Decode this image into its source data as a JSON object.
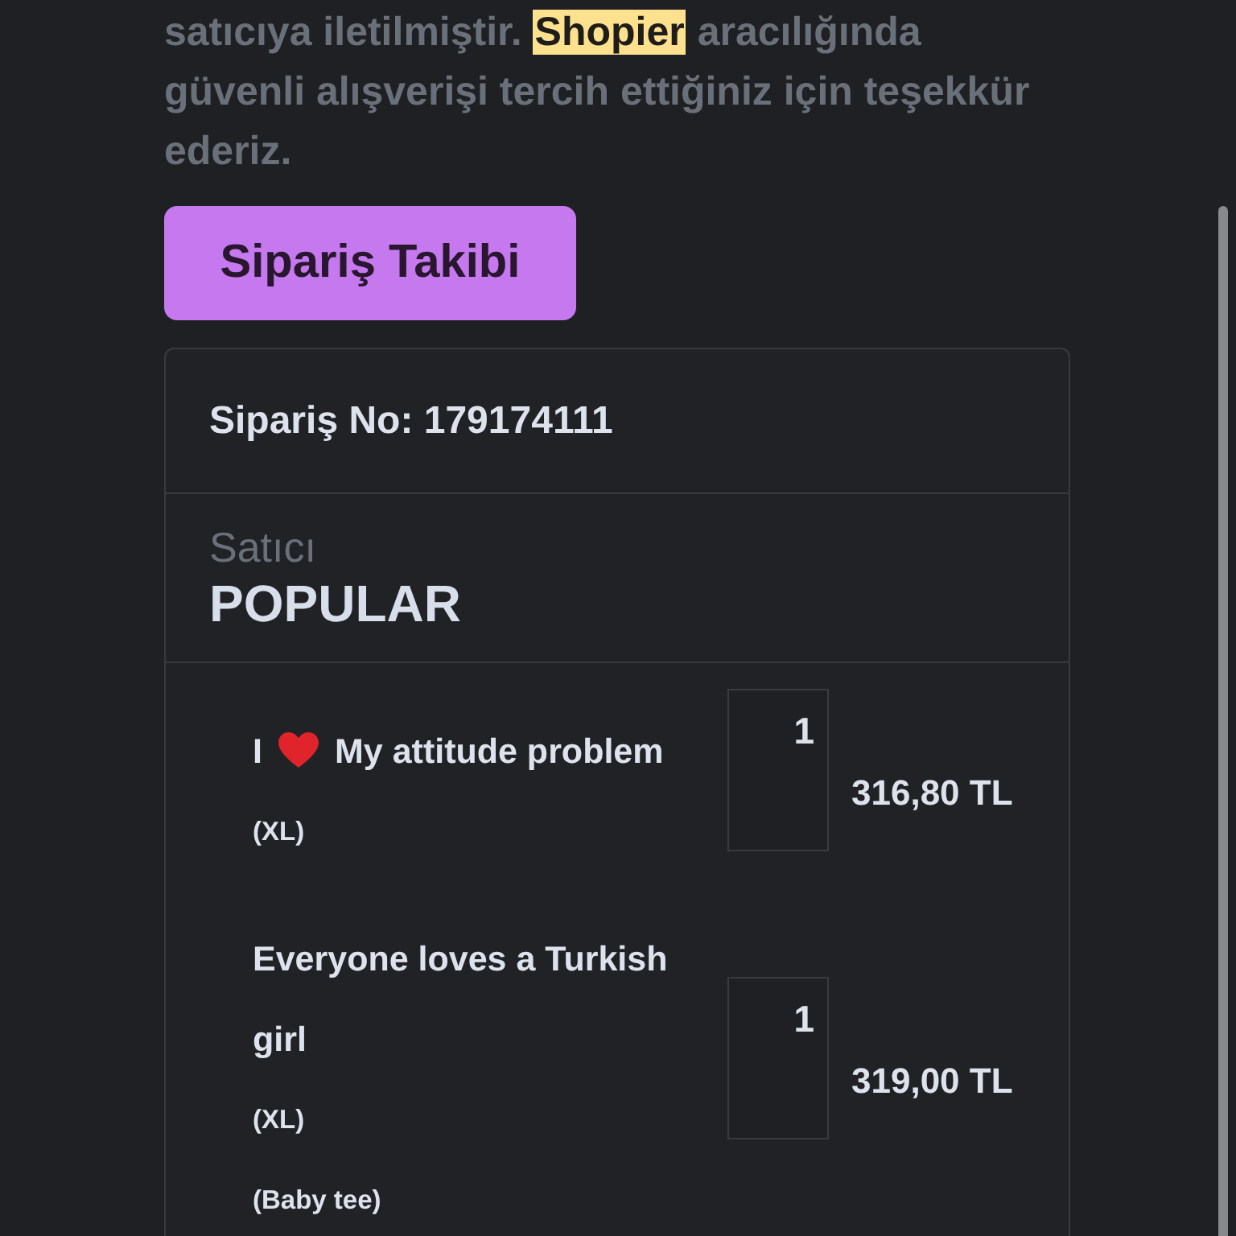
{
  "message": {
    "parts": [
      {
        "text": "satıcıya iletilmiştir. ",
        "highlighted": false
      },
      {
        "text": "Shopier",
        "highlighted": true
      },
      {
        "text": " aracılığında güvenli alışverişi tercih ettiğiniz için teşekkür ederiz.",
        "highlighted": false
      }
    ]
  },
  "track_button": {
    "label": "Sipariş Takibi"
  },
  "order": {
    "number_label": "Sipariş No: 179174111",
    "seller_label": "Satıcı",
    "seller_name": "POPULAR",
    "items": [
      {
        "name": [
          {
            "kind": "text",
            "text": "I"
          },
          {
            "kind": "heart"
          },
          {
            "kind": "text",
            "text": "My attitude problem"
          }
        ],
        "options": [
          "(XL)"
        ],
        "quantity": "1",
        "price": "316,80 TL"
      },
      {
        "name": [
          {
            "kind": "text",
            "text": "Everyone loves a Turkish girl"
          }
        ],
        "options": [
          "(XL)",
          "(Baby tee)"
        ],
        "quantity": "1",
        "price": "319,00 TL"
      }
    ]
  }
}
